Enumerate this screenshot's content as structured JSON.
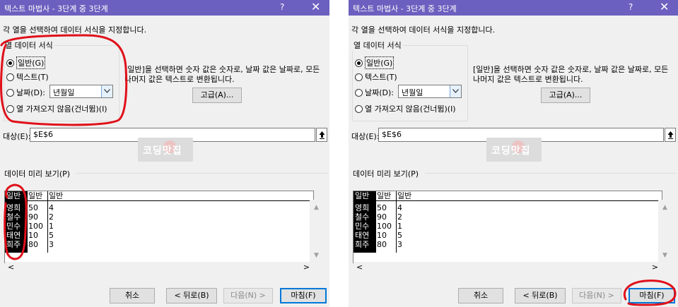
{
  "dialog": {
    "title": "텍스트 마법사 - 3단계 중 3단계",
    "help": "?",
    "close": "✕",
    "instruction": "각 열을 선택하여 데이터 서식을 지정합니다.",
    "group_label": "열 데이터 서식",
    "radio_general": "일반(G)",
    "radio_text": "텍스트(T)",
    "radio_date": "날짜(D):",
    "radio_skip": "열 가져오지 않음(건너뜀)(I)",
    "date_combo_value": "년월일",
    "desc_line1": "[일반]을 선택하면 숫자 값은 숫자로, 날짜 값은 날짜로, 모든",
    "desc_line2": "나머지 값은 텍스트로 변환됩니다.",
    "advanced_button": "고급(A)...",
    "target_label": "대상(E):",
    "target_value": "$E$6",
    "watermark": "코딩맛집",
    "preview_label": "데이터 미리 보기(P)",
    "preview_headers": [
      "일반",
      "일반",
      "일반"
    ],
    "preview_rows": [
      [
        "영희",
        "50",
        "4"
      ],
      [
        "철수",
        "90",
        "2"
      ],
      [
        "민수",
        "100",
        "1"
      ],
      [
        "태연",
        "10",
        "5"
      ],
      [
        "희주",
        "80",
        "3"
      ]
    ],
    "cancel_button": "취소",
    "back_button": "< 뒤로(B)",
    "next_button": "다음(N) >",
    "finish_button": "마침(F)"
  },
  "colors": {
    "titlebar": "#6b5fbf",
    "annotation_red": "#e0101a"
  }
}
